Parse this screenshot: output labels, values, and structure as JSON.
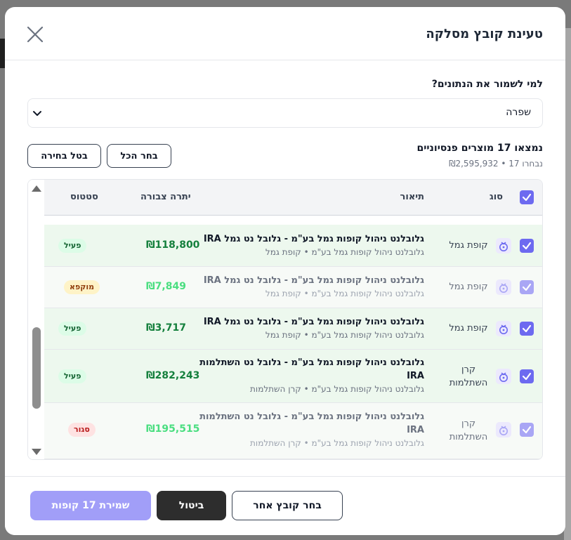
{
  "modal": {
    "title": "טעינת קובץ מסלקה",
    "question": "למי לשמור את הנתונים?",
    "owner_select": {
      "value": "שפרה"
    },
    "summary": {
      "title": "נמצאו 17 מוצרים פנסיוניים",
      "subtitle": "נבחרו 17 • ₪2,595,932"
    },
    "buttons": {
      "select_all": "בחר הכל",
      "deselect": "בטל בחירה"
    },
    "table": {
      "headers": {
        "type": "סוג",
        "description": "תיאור",
        "balance": "יתרה צבורה",
        "status": "סטטוס"
      },
      "rows": [
        {
          "type": "קופת גמל",
          "desc": "גלובלנט ניהול קופות גמל בע\"מ - גלובל נט גמל IRA",
          "sub": "גלובלנט ניהול קופות גמל בע\"מ • קופת גמל",
          "balance": "₪118,800",
          "status": "פעיל",
          "status_kind": "green",
          "checked": true
        },
        {
          "type": "קופת גמל",
          "desc": "גלובלנט ניהול קופות גמל בע\"מ - גלובל נט גמל IRA",
          "sub": "גלובלנט ניהול קופות גמל בע\"מ • קופת גמל",
          "balance": "₪7,849",
          "status": "מוקפא",
          "status_kind": "yellow",
          "checked": true
        },
        {
          "type": "קופת גמל",
          "desc": "גלובלנט ניהול קופות גמל בע\"מ - גלובל נט גמל IRA",
          "sub": "גלובלנט ניהול קופות גמל בע\"מ • קופת גמל",
          "balance": "₪3,717",
          "status": "פעיל",
          "status_kind": "green",
          "checked": true
        },
        {
          "type": "קרן השתלמות",
          "desc": "גלובלנט ניהול קופות גמל בע\"מ - גלובל נט השתלמות IRA",
          "sub": "גלובלנט ניהול קופות גמל בע\"מ • קרן השתלמות",
          "balance": "₪282,243",
          "status": "פעיל",
          "status_kind": "green",
          "checked": true
        },
        {
          "type": "קרן השתלמות",
          "desc": "גלובלנט ניהול קופות גמל בע\"מ - גלובל נט השתלמות IRA",
          "sub": "גלובלנט ניהול קופות גמל בע\"מ • קרן השתלמות",
          "balance": "₪195,515",
          "status": "סגור",
          "status_kind": "red",
          "checked": true
        }
      ]
    },
    "footer": {
      "choose_other": "בחר קובץ אחר",
      "cancel": "ביטול",
      "save": "שמירת 17 קופות"
    }
  },
  "colors": {
    "accent": "#6d6af0",
    "save_button": "#a19ef8",
    "cancel_button": "#2d2d2d",
    "active_row": "#edf8ee",
    "balance_green": "#15803d"
  },
  "icons": {
    "close": "close-icon",
    "chevron": "chevron-down-icon",
    "checkbox": "check-icon",
    "type": "money-bag-icon"
  }
}
